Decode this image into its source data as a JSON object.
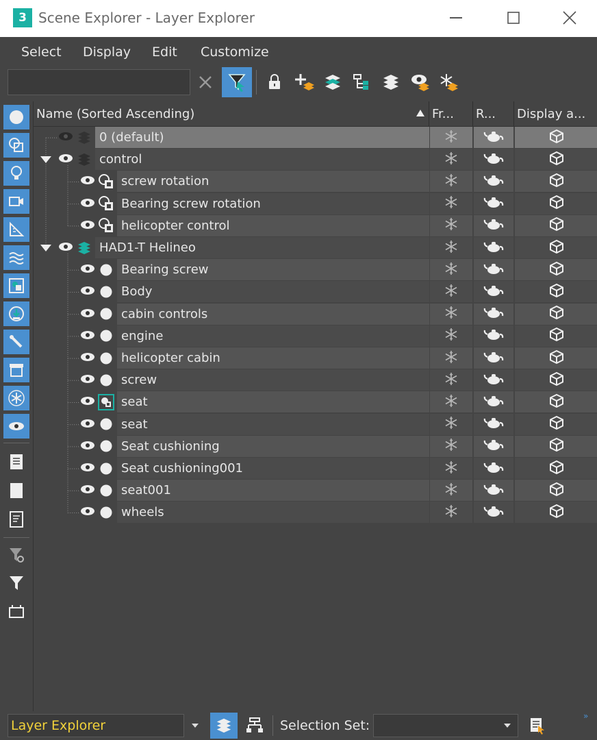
{
  "window": {
    "title": "Scene Explorer - Layer Explorer",
    "app_icon_text": "3"
  },
  "menu": [
    "Select",
    "Display",
    "Edit",
    "Customize"
  ],
  "search": {
    "value": ""
  },
  "columns": {
    "name": "Name (Sorted Ascending)",
    "freeze": "Fr...",
    "render": "R...",
    "display": "Display a..."
  },
  "rows": [
    {
      "label": "0 (default)",
      "depth": 0,
      "kind": "layer-gray",
      "expandable": false,
      "selected": true,
      "eye": "hidden"
    },
    {
      "label": "control",
      "depth": 0,
      "kind": "layer-gray",
      "expandable": true,
      "eye": "visible"
    },
    {
      "label": "screw rotation",
      "depth": 1,
      "kind": "helper",
      "eye": "visible"
    },
    {
      "label": "Bearing screw rotation",
      "depth": 1,
      "kind": "helper",
      "eye": "visible"
    },
    {
      "label": "helicopter control",
      "depth": 1,
      "kind": "helper",
      "eye": "visible"
    },
    {
      "label": "HAD1-T Helineo",
      "depth": 0,
      "kind": "layer-active",
      "expandable": true,
      "eye": "visible"
    },
    {
      "label": "Bearing screw",
      "depth": 1,
      "kind": "object",
      "eye": "visible"
    },
    {
      "label": "Body",
      "depth": 1,
      "kind": "object",
      "eye": "visible"
    },
    {
      "label": "cabin controls",
      "depth": 1,
      "kind": "object",
      "eye": "visible"
    },
    {
      "label": "engine",
      "depth": 1,
      "kind": "object",
      "eye": "visible"
    },
    {
      "label": "helicopter cabin",
      "depth": 1,
      "kind": "object",
      "eye": "visible"
    },
    {
      "label": "screw",
      "depth": 1,
      "kind": "object",
      "eye": "visible"
    },
    {
      "label": "seat",
      "depth": 1,
      "kind": "group",
      "eye": "visible"
    },
    {
      "label": "seat",
      "depth": 1,
      "kind": "object",
      "eye": "visible"
    },
    {
      "label": "Seat cushioning",
      "depth": 1,
      "kind": "object",
      "eye": "visible"
    },
    {
      "label": "Seat cushioning001",
      "depth": 1,
      "kind": "object",
      "eye": "visible"
    },
    {
      "label": "seat001",
      "depth": 1,
      "kind": "object",
      "eye": "visible"
    },
    {
      "label": "wheels",
      "depth": 1,
      "kind": "object",
      "eye": "visible"
    }
  ],
  "bottom": {
    "explorer_mode": "Layer Explorer",
    "selection_set_label": "Selection Set:",
    "selection_set_value": ""
  },
  "colors": {
    "accent": "#4a90d0",
    "teal": "#1bb1a4",
    "mode_text": "#f2d23a"
  }
}
